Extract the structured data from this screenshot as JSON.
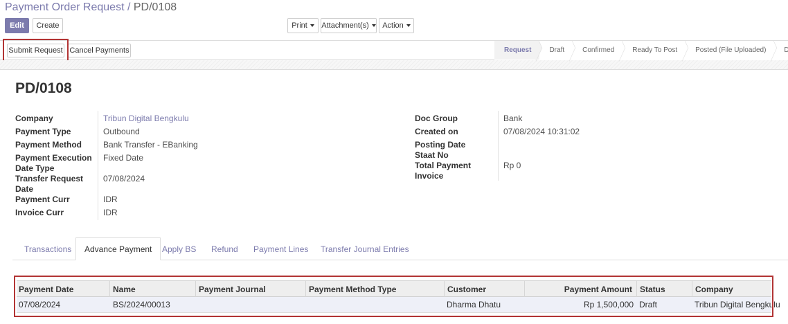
{
  "breadcrumb": {
    "parent": "Payment Order Request /",
    "current": "PD/0108"
  },
  "buttons": {
    "edit": "Edit",
    "create": "Create",
    "print": "Print",
    "attachments": "Attachment(s)",
    "action": "Action",
    "submit_request": "Submit Request",
    "cancel_payments": "Cancel Payments"
  },
  "statusbar": [
    "Request",
    "Draft",
    "Confirmed",
    "Ready To Post",
    "Posted (File Uploaded)",
    "Do"
  ],
  "record": {
    "title": "PD/0108",
    "left_fields": [
      {
        "label": "Company",
        "value": "Tribun Digital Bengkulu"
      },
      {
        "label": "Payment Type",
        "value": "Outbound"
      },
      {
        "label": "Payment Method",
        "value": "Bank Transfer - EBanking"
      },
      {
        "label_line1": "Payment Execution",
        "label_line2": "Date Type",
        "value": "Fixed Date"
      },
      {
        "label_line1": "Transfer Request",
        "label_line2": "Date",
        "value": "07/08/2024"
      },
      {
        "label": "Payment Curr",
        "value": "IDR"
      },
      {
        "label": "Invoice Curr",
        "value": "IDR"
      }
    ],
    "right_fields": [
      {
        "label": "Doc Group",
        "value": "Bank"
      },
      {
        "label": "Created on",
        "value": "07/08/2024 10:31:02"
      },
      {
        "label": "Posting Date",
        "value": ""
      },
      {
        "label": "Staat No",
        "value": ""
      },
      {
        "label": "Total Payment",
        "value": "Rp 0"
      },
      {
        "label": "Invoice",
        "value": ""
      }
    ]
  },
  "tabs": [
    "Transactions",
    "Advance Payment",
    "Apply BS",
    "Refund",
    "Payment Lines",
    "Transfer Journal Entries"
  ],
  "table": {
    "headers": [
      "Payment Date",
      "Name",
      "Payment Journal",
      "Payment Method Type",
      "Customer",
      "Payment Amount",
      "Status",
      "Company"
    ],
    "rows": [
      [
        "07/08/2024",
        "BS/2024/00013",
        "",
        "",
        "Dharma Dhatu",
        "Rp 1,500,000",
        "Draft",
        "Tribun Digital Bengkulu"
      ]
    ]
  },
  "colors": {
    "accent": "#7c7bad",
    "highlight_frame": "#b23434"
  }
}
